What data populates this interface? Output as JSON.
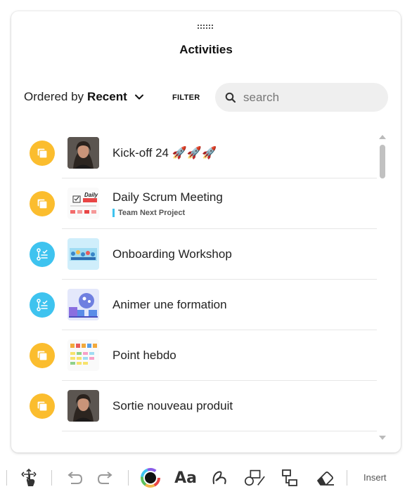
{
  "panel": {
    "title": "Activities",
    "order_prefix": "Ordered by",
    "order_value": "Recent",
    "filter_label": "FILTER",
    "search_placeholder": "search"
  },
  "activities": [
    {
      "title": "Kick-off 24 🚀🚀🚀",
      "tag": "",
      "type": "folder",
      "thumb": "person"
    },
    {
      "title": "Daily Scrum Meeting",
      "tag": "Team Next Project",
      "type": "folder",
      "thumb": "daily"
    },
    {
      "title": "Onboarding Workshop",
      "tag": "",
      "type": "workshop",
      "thumb": "onboarding"
    },
    {
      "title": "Animer une formation",
      "tag": "",
      "type": "workshop",
      "thumb": "formation"
    },
    {
      "title": "Point hebdo",
      "tag": "",
      "type": "folder",
      "thumb": "hebdo"
    },
    {
      "title": "Sortie nouveau produit",
      "tag": "",
      "type": "folder",
      "thumb": "person"
    }
  ],
  "toolbar": {
    "insert_label": "Insert",
    "icons": [
      "move-icon",
      "undo-icon",
      "redo-icon",
      "color-picker-icon",
      "text-icon",
      "pen-icon",
      "shapes-icon",
      "connector-icon",
      "eraser-icon"
    ]
  },
  "colors": {
    "accent_orange": "#fbbd2e",
    "accent_blue": "#3ec3ef",
    "search_bg": "#efefef"
  }
}
